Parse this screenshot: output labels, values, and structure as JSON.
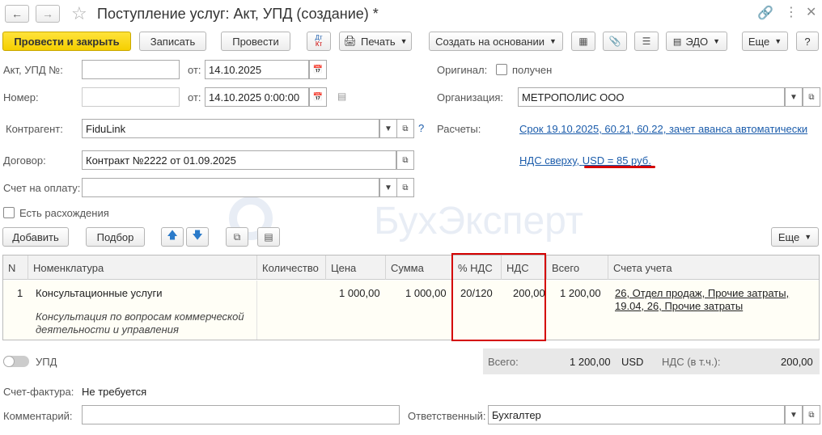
{
  "window": {
    "title": "Поступление услуг: Акт, УПД (создание) *",
    "star_icon": "star-icon",
    "link_icon": "link-icon",
    "menu_icon": "more-vert-icon",
    "close_icon": "close-icon"
  },
  "toolbar": {
    "post_close": "Провести и закрыть",
    "save": "Записать",
    "post": "Провести",
    "dtkt_top": "Дт",
    "dtkt_bottom": "Кт",
    "print": "Печать",
    "create_based": "Создать на основании",
    "edo": "ЭДО",
    "more": "Еще",
    "help": "?"
  },
  "form": {
    "act_label": "Акт, УПД №:",
    "act_value": "",
    "from_label": "от:",
    "act_date": "14.10.2025",
    "number_label": "Номер:",
    "number_value": "",
    "from2_label": "от:",
    "number_date": "14.10.2025  0:00:00",
    "original_label": "Оригинал:",
    "received_label": "получен",
    "org_label": "Организация:",
    "org_value": "МЕТРОПОЛИС ООО",
    "contractor_label": "Контрагент:",
    "contractor_value": "FiduLink",
    "help_q": "?",
    "settlements_label": "Расчеты:",
    "settlements_link": "Срок 19.10.2025, 60.21, 60.22, зачет аванса автоматически",
    "contract_label": "Договор:",
    "contract_value": "Контракт №2222 от 01.09.2025",
    "vat_link_prefix": "НДС сверху, ",
    "vat_link_rate": "USD = 85 руб.",
    "invoice_label": "Счет на оплату:",
    "invoice_value": "",
    "discrepancy_label": "Есть расхождения"
  },
  "table_toolbar": {
    "add": "Добавить",
    "select": "Подбор",
    "more": "Еще"
  },
  "table": {
    "headers": [
      "N",
      "Номенклатура",
      "Количество",
      "Цена",
      "Сумма",
      "% НДС",
      "НДС",
      "Всего",
      "Счета учета"
    ],
    "rows": [
      {
        "n": "1",
        "item": "Консультационные услуги",
        "item_desc_1": "Консультация по вопросам коммерческой",
        "item_desc_2": "деятельности и управления",
        "qty": "",
        "price": "1 000,00",
        "sum": "1 000,00",
        "vat_rate": "20/120",
        "vat": "200,00",
        "total": "1 200,00",
        "accounts_1": "26, Отдел продаж, Прочие затраты,",
        "accounts_2": "19.04, 26, Прочие затраты"
      }
    ]
  },
  "totals": {
    "upd_label": "УПД",
    "total_label": "Всего:",
    "total_value": "1 200,00",
    "currency": "USD",
    "vat_label": "НДС (в т.ч.):",
    "vat_value": "200,00"
  },
  "footer": {
    "invoice_label": "Счет-фактура:",
    "invoice_value": "Не требуется",
    "comment_label": "Комментарий:",
    "comment_value": "",
    "responsible_label": "Ответственный:",
    "responsible_value": "Бухгалтер"
  },
  "watermark": "БухЭксперт",
  "colors": {
    "accent_yellow": "#f5cf00",
    "link": "#1b5cab",
    "highlight_red": "#d40000"
  }
}
